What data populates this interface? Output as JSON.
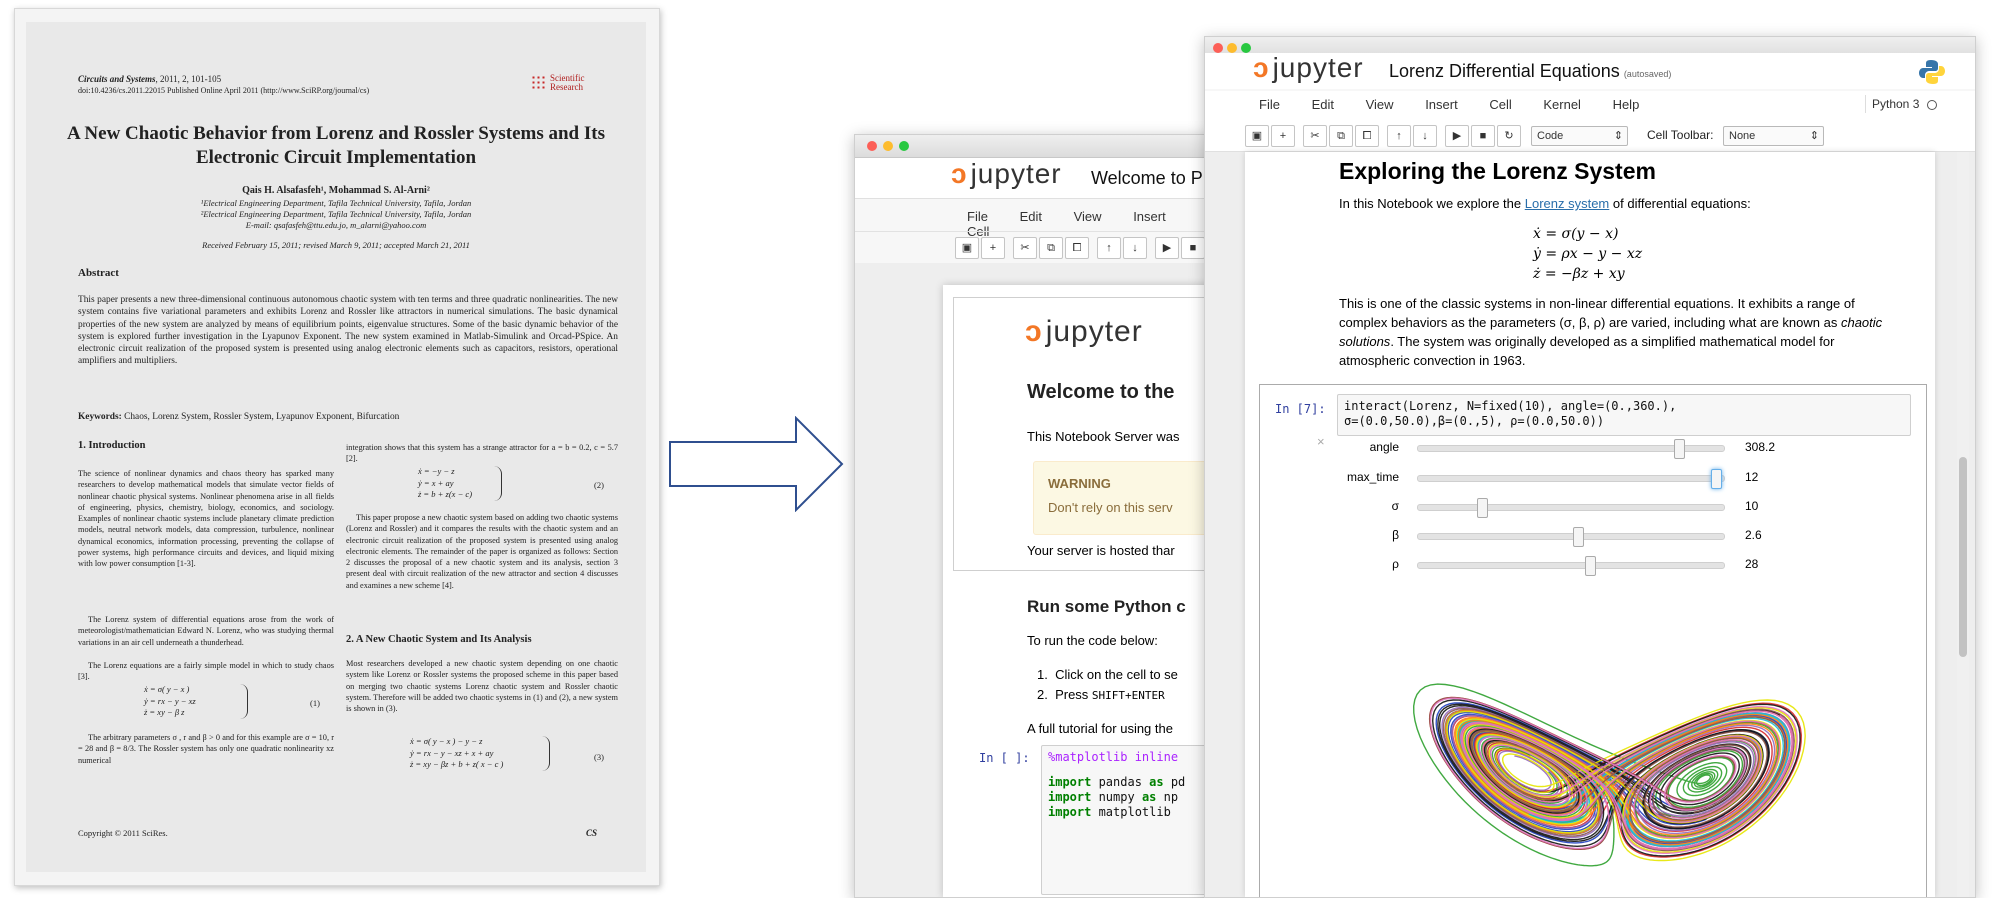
{
  "paper": {
    "journal": "Circuits and Systems",
    "journal_info": ", 2011, 2, 101-105",
    "doi_line": "doi:10.4236/cs.2011.22015 Published Online April 2011 (http://www.SciRP.org/journal/cs)",
    "publisher_logo": "Scientific Research",
    "title": "A New Chaotic Behavior from Lorenz and Rossler Systems and Its Electronic Circuit Implementation",
    "authors": "Qais H. Alsafasfeh¹, Mohammad S. Al-Arni²",
    "affiliation_1": "¹Electrical Engineering Department, Tafila Technical University, Tafila, Jordan",
    "affiliation_2": "²Electrical Engineering Department, Tafila Technical University, Tafila, Jordan",
    "emails": "E-mail: qsafasfeh@ttu.edu.jo, m_alarni@yahoo.com",
    "received": "Received February 15, 2011; revised March 9, 2011; accepted March 21, 2011",
    "abstract_heading": "Abstract",
    "abstract": "This paper presents a new three-dimensional continuous autonomous chaotic system with ten terms and three quadratic nonlinearities. The new system contains five variational parameters and exhibits Lorenz and Rossler like attractors in numerical simulations. The basic dynamical properties of the new system are analyzed by means of equilibrium points, eigenvalue structures. Some of the basic dynamic behavior of the system is explored further investigation in the Lyapunov Exponent. The new system examined in Matlab-Simulink and Orcad-PSpice. An electronic circuit realization of the proposed system is presented using analog electronic elements such as capacitors, resistors, operational amplifiers and multipliers.",
    "keywords_label": "Keywords:",
    "keywords": " Chaos, Lorenz System, Rossler System, Lyapunov Exponent, Bifurcation",
    "sec1_heading": "1. Introduction",
    "sec1_p1": "The science of nonlinear dynamics and chaos theory has sparked many researchers to develop mathematical models that simulate vector fields of nonlinear chaotic physical systems. Nonlinear phenomena arise in all fields of engineering, physics, chemistry, biology, economics, and sociology. Examples of nonlinear chaotic systems include planetary climate prediction models, neutral network models, data compression, turbulence, nonlinear dynamical economics, information processing, preventing the collapse of power systems, high performance circuits and devices, and liquid mixing with low power consumption [1-3].",
    "sec1_p2": "The Lorenz system of differential equations arose from the work of meteorologist/mathematician Edward N. Lorenz, who was studying thermal variations in an air cell underneath a thunderhead.",
    "sec1_p3": "The Lorenz equations are a fairly simple model in which to study chaos [3].",
    "eq1_a": "ẋ = σ( y − x )",
    "eq1_b": "ẏ = rx − y − xz",
    "eq1_c": "ż = xy − β  z",
    "eq1_num": "(1)",
    "sec1_p4": "The arbitrary parameters  σ , r and β > 0 and for this example are  σ  = 10,  r = 28 and β = 8/3. The Rossler system has only one quadratic nonlinearity xz numerical",
    "col2_p1": "integration shows that this system has a strange attractor for a = b = 0.2, c = 5.7 [2].",
    "eq2_a": "ẋ = −y − z",
    "eq2_b": "ẏ = x + ay",
    "eq2_c": "ż = b + z(x − c)",
    "eq2_num": "(2)",
    "col2_p2": "This paper propose a new chaotic system based on adding two chaotic systems (Lorenz and Rossler) and it compares the results with the chaotic system and an electronic circuit realization of the proposed system is presented using analog electronic elements. The remainder of the paper is organized as follows: Section 2 discusses the proposal of a new chaotic system and its analysis, section 3 present deal with circuit realization of the new attractor and section 4 discusses and examines a new scheme [4].",
    "sec2_heading": "2. A New Chaotic System and Its Analysis",
    "col2_p3": "Most researchers developed a new chaotic system depending on one chaotic system like Lorenz or Rossler systems the proposed scheme in this paper based on merging two chaotic systems Lorenz chaotic system and Rossler chaotic system. Therefore will be added two chaotic systems in (1) and (2), a new system is shown in (3).",
    "eq3_a": "ẋ = σ( y − x ) − y − z",
    "eq3_b": "ẏ = rx − y − xz + x + ay",
    "eq3_c": "ż = xy − βz + b + z( x − c )",
    "eq3_num": "(3)",
    "copyright": "Copyright © 2011 SciRes.",
    "footer_journal": "CS"
  },
  "back_window": {
    "logo_text": "jupyter",
    "notebook_title": "Welcome to P",
    "menu": [
      "File",
      "Edit",
      "View",
      "Insert",
      "Cell"
    ],
    "inner_logo": "jupyter",
    "heading": "Welcome to the",
    "intro": "This Notebook Server was",
    "warning_title": "WARNING",
    "warning_text": "Don't rely on this serv",
    "hosted": "Your server is hosted thar",
    "run_heading": "Run some Python c",
    "run_intro": "To run the code below:",
    "step1": "Click on the cell to se",
    "step2_pre": "Press ",
    "step2_code": "SHIFT+ENTER",
    "tutorial": "A full tutorial for using the",
    "prompt": "In [ ]:",
    "code1": "%matplotlib inline",
    "code2_kw": "import",
    "code2_rest": " pandas ",
    "code2_as": "as",
    "code2_alias": " pd",
    "code3_kw": "import",
    "code3_rest": " numpy ",
    "code3_as": "as",
    "code3_alias": " np",
    "code4_kw": "import",
    "code4_rest": " matplotlib"
  },
  "front_window": {
    "logo_text": "jupyter",
    "notebook_title": "Lorenz Differential Equations",
    "autosaved": "(autosaved)",
    "menu": [
      "File",
      "Edit",
      "View",
      "Insert",
      "Cell",
      "Kernel",
      "Help"
    ],
    "kernel": "Python 3",
    "cell_type": "Code",
    "cell_toolbar_label": "Cell Toolbar:",
    "cell_toolbar_value": "None",
    "heading": "Exploring the Lorenz System",
    "intro_pre": "In this Notebook we explore the ",
    "intro_link": "Lorenz system",
    "intro_post": " of differential equations:",
    "eq_x": "ẋ = σ(y − x)",
    "eq_y": "ẏ = ρx − y − xz",
    "eq_z": "ż = −βz + xy",
    "para1": "This is one of the classic systems in non-linear differential equations. It exhibits a range of complex behaviors as the parameters (σ, β, ρ) are varied, including what are known as ",
    "para1_em": "chaotic solutions",
    "para1_post": ". The system was originally developed as a simplified mathematical model for atmospheric convection in 1963.",
    "prompt": "In [7]:",
    "code_line1": "interact(Lorenz, N=fixed(10), angle=(0.,360.),",
    "code_line2": "         σ=(0.0,50.0),β=(0.,5), ρ=(0.0,50.0))",
    "close_x": "×",
    "sliders": [
      {
        "label": "angle",
        "value": "308.2",
        "fraction": 0.856
      },
      {
        "label": "max_time",
        "value": "12",
        "fraction": 0.98
      },
      {
        "label": "σ",
        "value": "10",
        "fraction": 0.2
      },
      {
        "label": "β",
        "value": "2.6",
        "fraction": 0.52
      },
      {
        "label": "ρ",
        "value": "28",
        "fraction": 0.56
      }
    ],
    "plot_colors": [
      "#1f3fbf",
      "#d62728",
      "#2ca02c",
      "#9467bd",
      "#17becf",
      "#ff7f0e",
      "#111111",
      "#e6e600",
      "#8c564b",
      "#e377c2"
    ]
  },
  "arrow": {
    "fill": "#ffffff",
    "stroke": "#2f4f8f"
  }
}
